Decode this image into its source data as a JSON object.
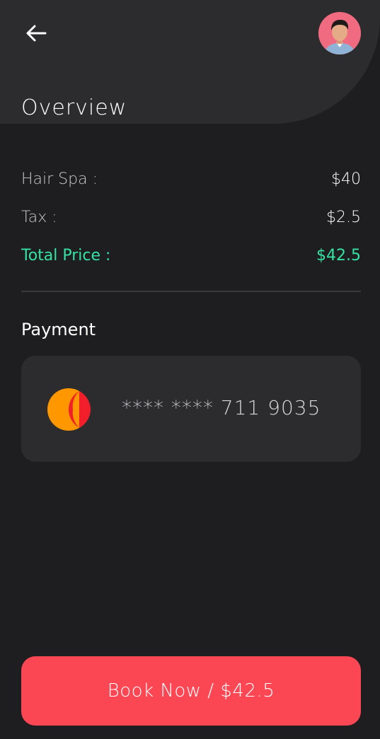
{
  "header": {
    "title": "Overview"
  },
  "summary": {
    "items": [
      {
        "label": "Hair Spa :",
        "value": "$40"
      },
      {
        "label": "Tax :",
        "value": "$2.5"
      }
    ],
    "total": {
      "label": "Total Price :",
      "value": "$42.5"
    }
  },
  "payment": {
    "title": "Payment",
    "card_number": "**** **** 711 9035",
    "card_brand_icon": "mastercard-icon"
  },
  "cta": {
    "label": "Book Now / $42.5"
  },
  "colors": {
    "background": "#1e1e20",
    "surface": "#2c2c2f",
    "accent_green": "#34e3a4",
    "cta_red": "#fb4654",
    "mastercard_orange": "#ff9800",
    "mastercard_red": "#f21f2a"
  }
}
